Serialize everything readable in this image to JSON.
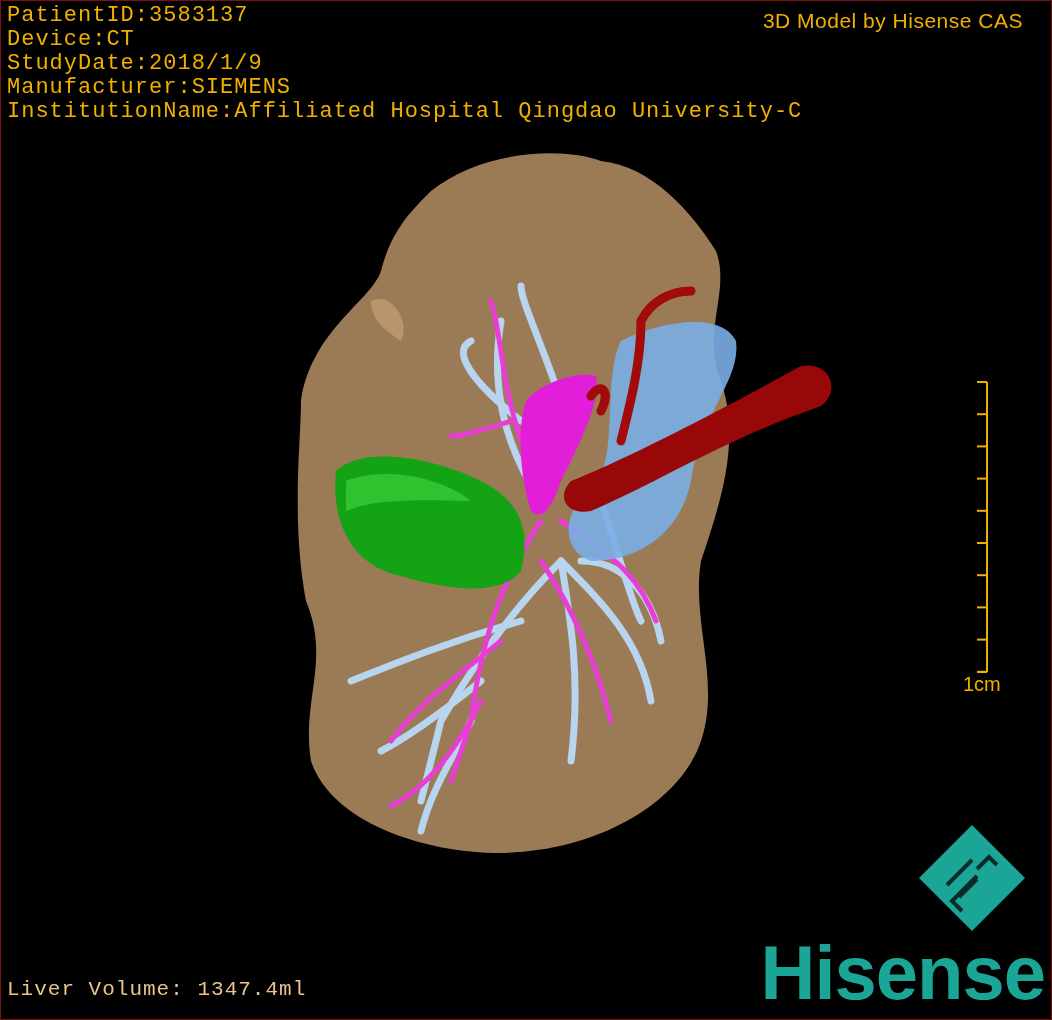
{
  "viewport": {
    "info_lines": [
      "PatientID:3583137",
      "Device:CT",
      "StudyDate:2018/1/9",
      "Manufacturer:SIEMENS",
      "InstitutionName:Affiliated Hospital Qingdao University-C"
    ],
    "title": "3D Model by Hisense CAS",
    "scale_bar": {
      "label": "1cm"
    },
    "volume": "Liver Volume: 1347.4ml",
    "logo": {
      "text": "Hisense"
    }
  }
}
